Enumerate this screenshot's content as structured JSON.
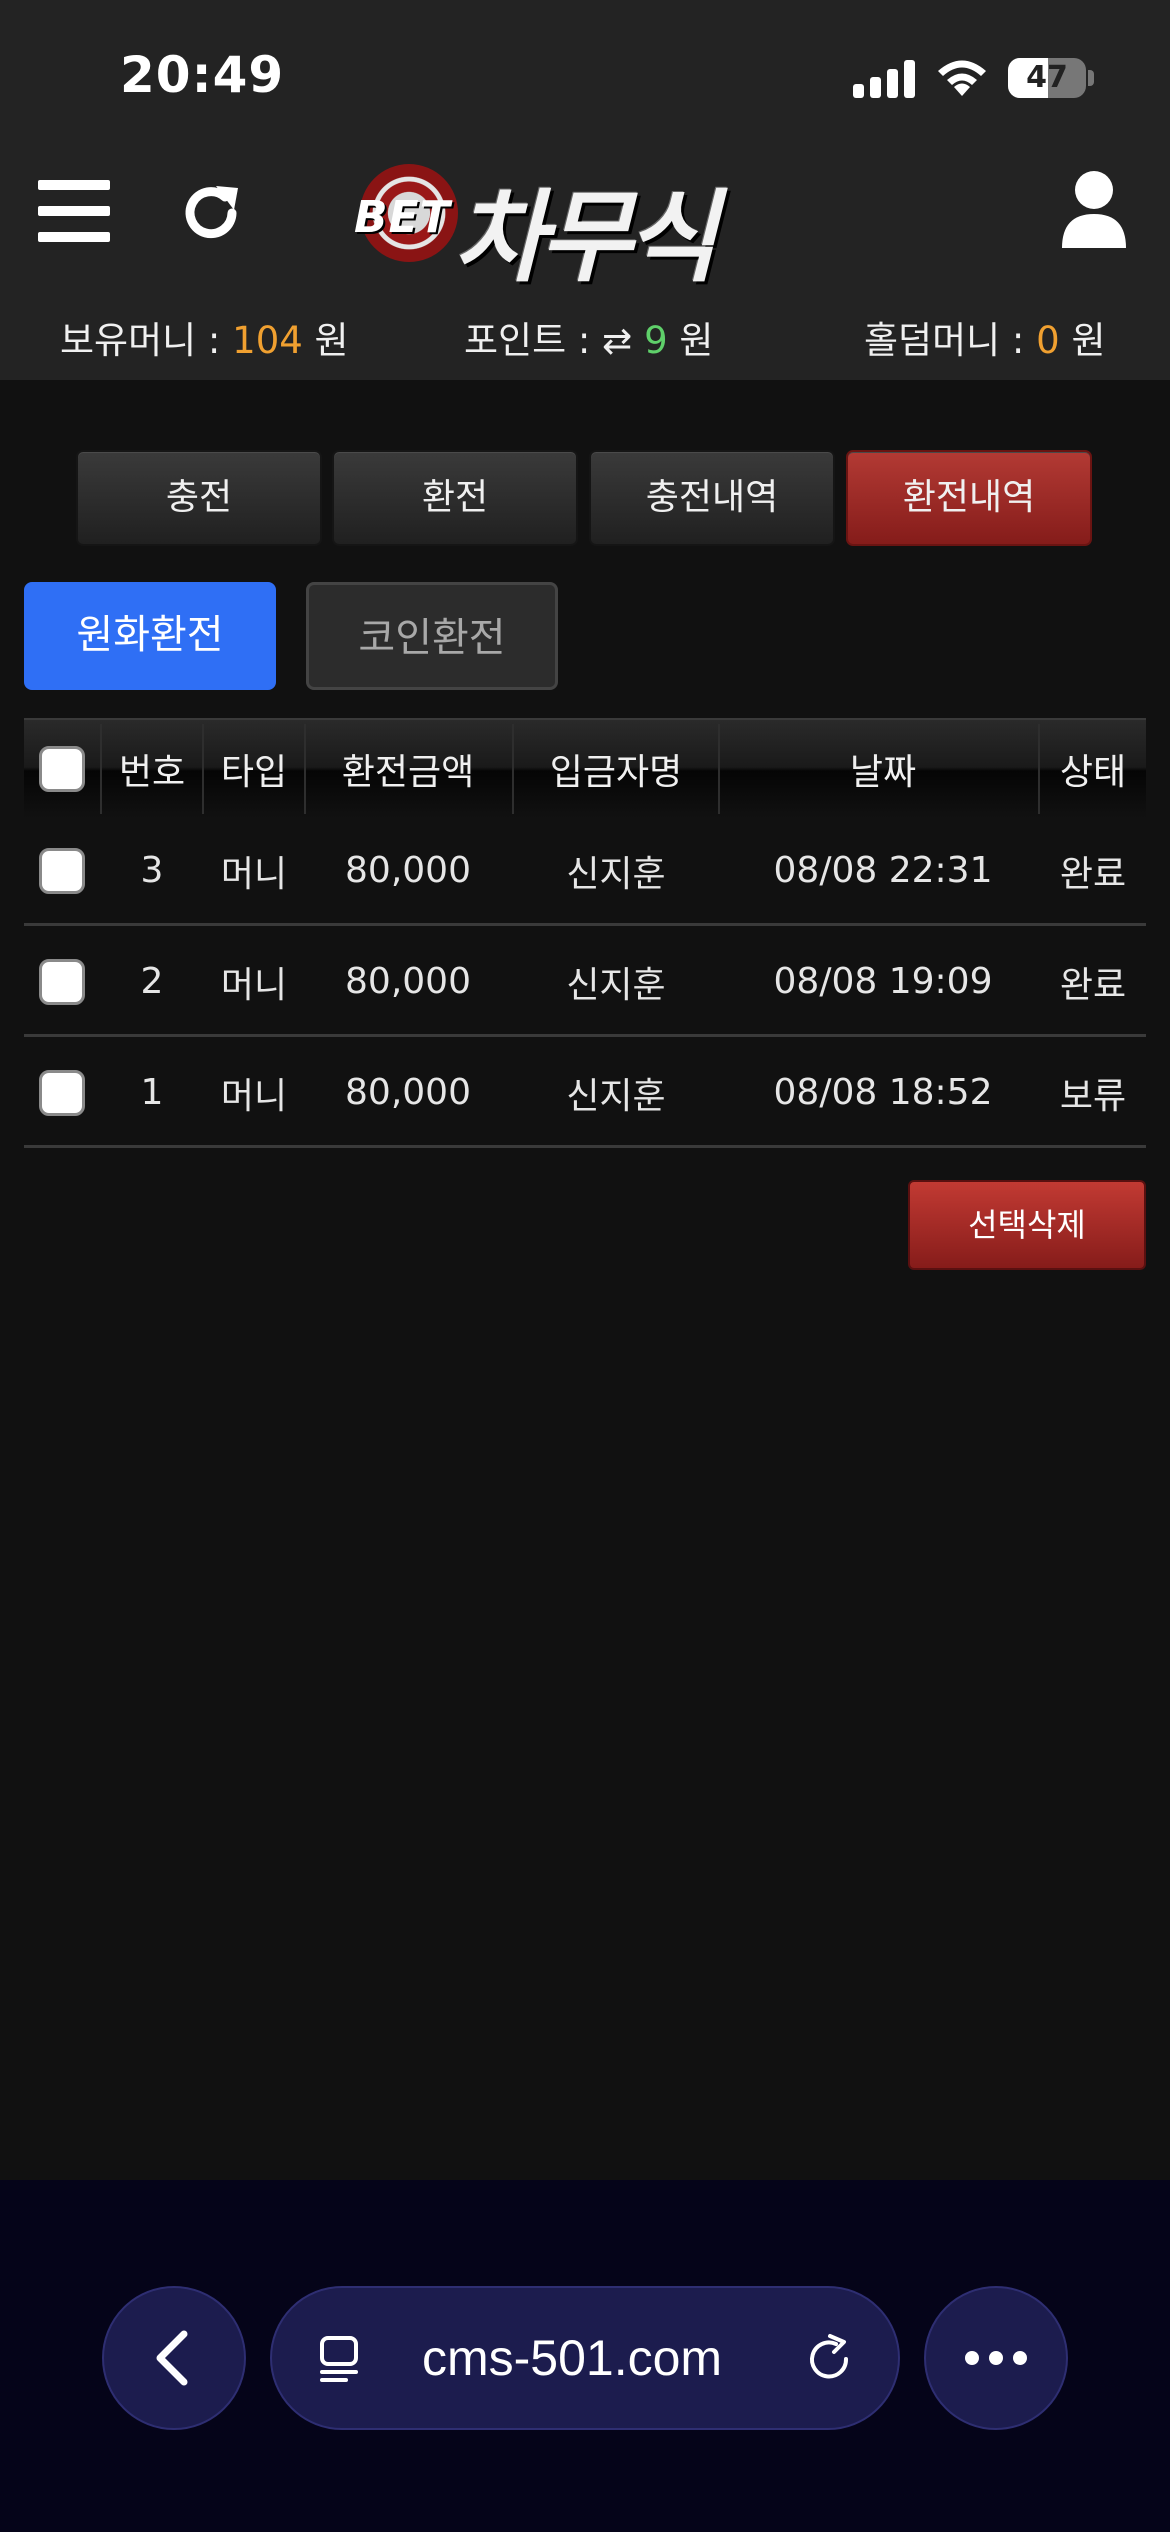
{
  "status_bar": {
    "time": "20:49",
    "battery": "47"
  },
  "header": {
    "logo_bet": "BET",
    "logo_brand": "차무식",
    "balances": {
      "money_label": "보유머니 :",
      "money_value": "104",
      "money_unit": "원",
      "point_label": "포인트 :",
      "point_value": "9",
      "point_unit": "원",
      "holdem_label": "홀덤머니 :",
      "holdem_value": "0",
      "holdem_unit": "원"
    }
  },
  "tabs": [
    "충전",
    "환전",
    "충전내역",
    "환전내역"
  ],
  "active_tab": "환전내역",
  "subtabs": {
    "fiat": "원화환전",
    "coin": "코인환전"
  },
  "table": {
    "headers": [
      "번호",
      "타입",
      "환전금액",
      "입금자명",
      "날짜",
      "상태"
    ],
    "rows": [
      {
        "no": "3",
        "type": "머니",
        "amount": "80,000",
        "depositor": "신지훈",
        "date": "08/08 22:31",
        "status": "완료"
      },
      {
        "no": "2",
        "type": "머니",
        "amount": "80,000",
        "depositor": "신지훈",
        "date": "08/08 19:09",
        "status": "완료"
      },
      {
        "no": "1",
        "type": "머니",
        "amount": "80,000",
        "depositor": "신지훈",
        "date": "08/08 18:52",
        "status": "보류"
      }
    ]
  },
  "delete_button": "선택삭제",
  "browser": {
    "url": "cms-501.com"
  },
  "colors": {
    "accent_blue": "#2f6ff5",
    "accent_red": "#a52a26",
    "amount_orange": "#f0a030",
    "amount_green": "#5fd06a",
    "browser_bar": "#050419"
  }
}
